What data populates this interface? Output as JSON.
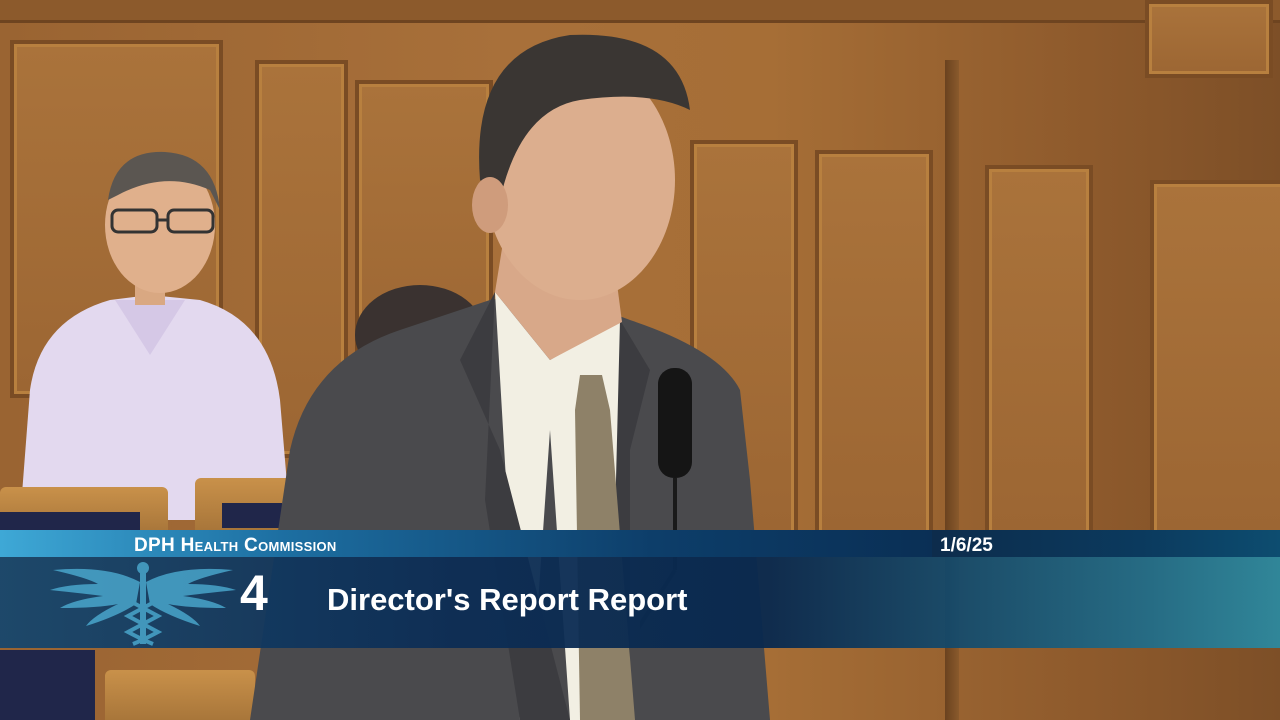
{
  "banner": {
    "organization": "DPH Health Commission",
    "date": "1/6/25",
    "item_number": "4",
    "item_title": "Director's Report Report"
  },
  "logo": {
    "icon": "caduceus-wings-icon"
  },
  "colors": {
    "banner_light_blue": "#3ea8d6",
    "banner_dark_blue": "#0a2f55",
    "banner_teal": "#28a0b5",
    "wood_panel": "#a66e36",
    "suit_gray": "#4a4a4d"
  }
}
